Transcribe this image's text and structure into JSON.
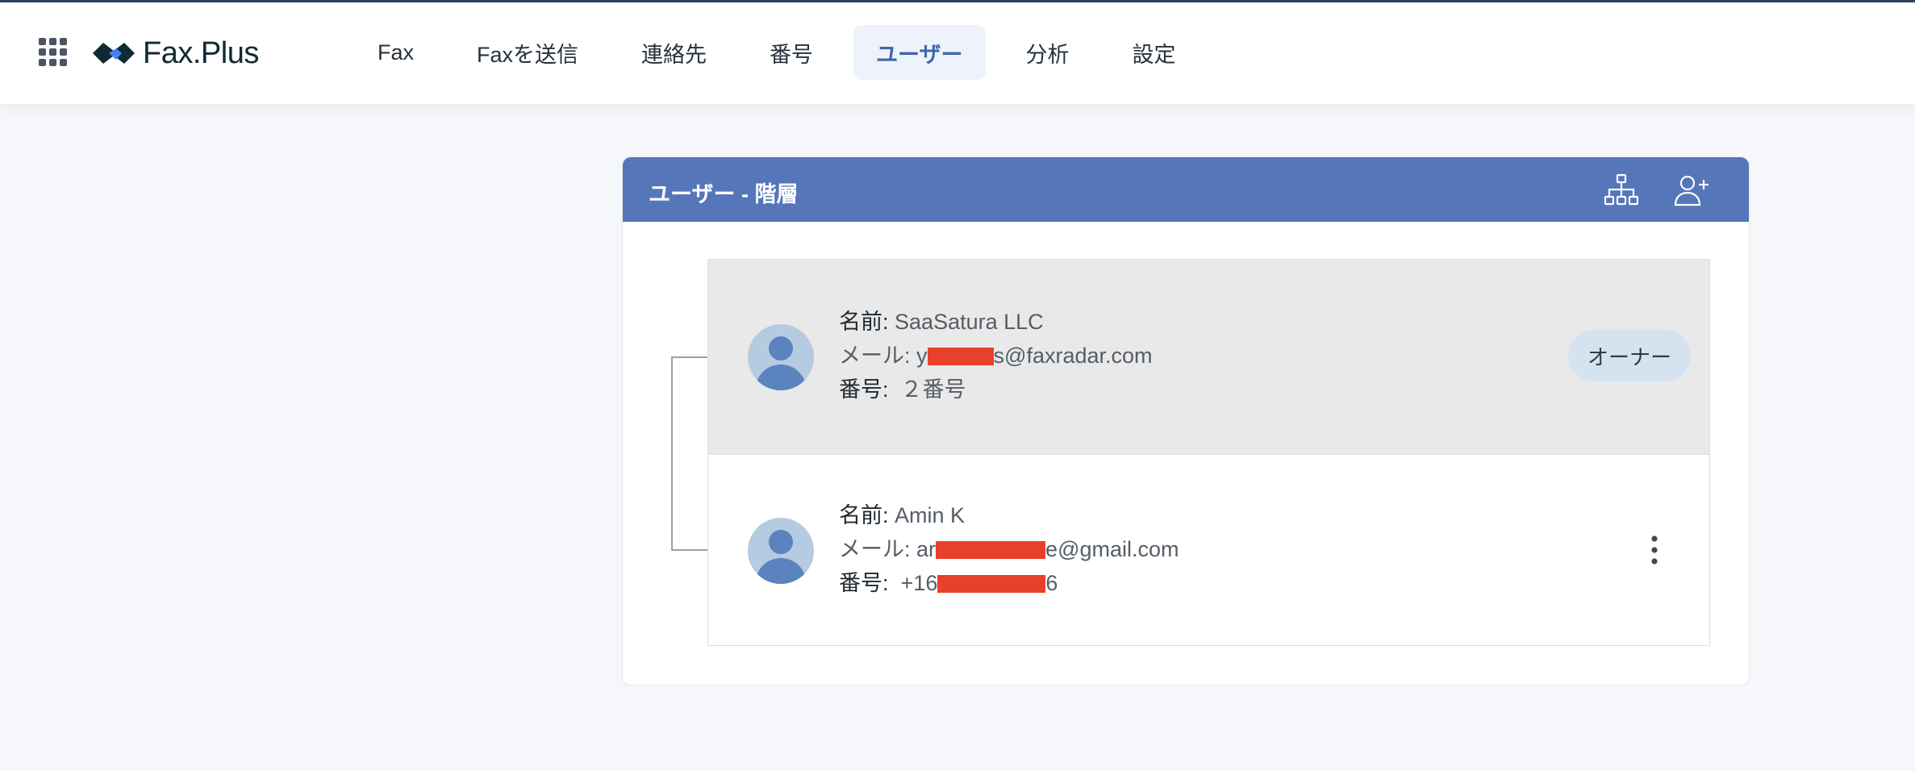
{
  "header": {
    "brand": "Fax.Plus",
    "nav": [
      {
        "label": "Fax"
      },
      {
        "label": "Faxを送信"
      },
      {
        "label": "連絡先"
      },
      {
        "label": "番号"
      },
      {
        "label": "ユーザー",
        "active": true
      },
      {
        "label": "分析"
      },
      {
        "label": "設定"
      }
    ]
  },
  "panel": {
    "title": "ユーザー - 階層",
    "actions": [
      "hierarchy-icon",
      "add-user-icon"
    ]
  },
  "users": [
    {
      "name_label": "名前:",
      "name": "SaaSatura LLC",
      "email_label": "メール:",
      "email_prefix": "y",
      "email_suffix": "s@faxradar.com",
      "number_label": "番号:",
      "number": "２番号",
      "badge": "オーナー"
    },
    {
      "name_label": "名前:",
      "name": "Amin K",
      "email_label": "メール:",
      "email_prefix": "ar",
      "email_suffix": "e@gmail.com",
      "number_label": "番号:",
      "number_prefix": "+16",
      "number_suffix": "6"
    }
  ],
  "colors": {
    "accent": "#5576b9",
    "active_nav_bg": "#eef3fb",
    "owner_badge": "#d5e3f1",
    "redaction": "#e8412a",
    "selected_row": "#e9e9e9"
  }
}
